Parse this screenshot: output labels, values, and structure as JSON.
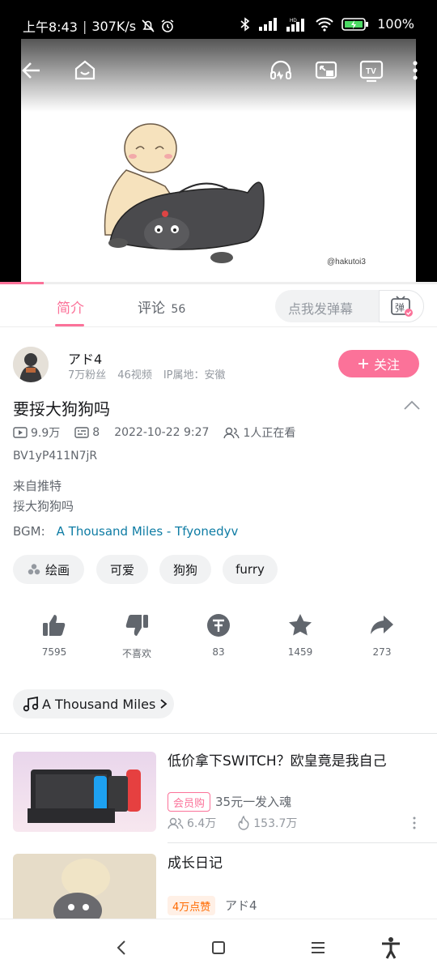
{
  "status_bar": {
    "time": "上午8:43",
    "net_speed": "307K/s",
    "battery": "100%"
  },
  "video": {
    "watermark": "@hakutoi3",
    "progress": 0.1
  },
  "tabs": [
    {
      "label": "简介",
      "active": true
    },
    {
      "label": "评论",
      "count": "56",
      "active": false
    }
  ],
  "danmaku": {
    "placeholder": "点我发弹幕",
    "button_label": "弹"
  },
  "uploader": {
    "name": "アド4",
    "fans": "7万粉丝",
    "videos": "46视频",
    "ip": "IP属地：安徽",
    "follow_label": "关注"
  },
  "video_info": {
    "title": "要挼大狗狗吗",
    "views": "9.9万",
    "danmaku_count": "8",
    "date": "2022-10-22 9:27",
    "watching": "1人正在看",
    "bvid": "BV1yP411N7jR",
    "desc_line1": "来自推特",
    "desc_line2": "挼大狗狗吗",
    "bgm_label": "BGM:",
    "bgm_link": "A Thousand Miles - Tfyonedyv"
  },
  "tags": [
    "绘画",
    "可爱",
    "狗狗",
    "furry"
  ],
  "actions": {
    "like": "7595",
    "dislike": "不喜欢",
    "coin": "83",
    "favorite": "1459",
    "share": "273"
  },
  "music": {
    "label": "A Thousand Miles"
  },
  "recommendations": [
    {
      "title": "低价拿下SWITCH？欧皇竟是我自己",
      "badge": "会员购",
      "subtitle": "35元一发入魂",
      "viewers": "6.4万",
      "hot": "153.7万"
    },
    {
      "title": "成长日记",
      "badge": "4万点赞",
      "subtitle": "アド4"
    }
  ],
  "colors": {
    "accent": "#fb7299",
    "link": "#0e7ca4"
  }
}
